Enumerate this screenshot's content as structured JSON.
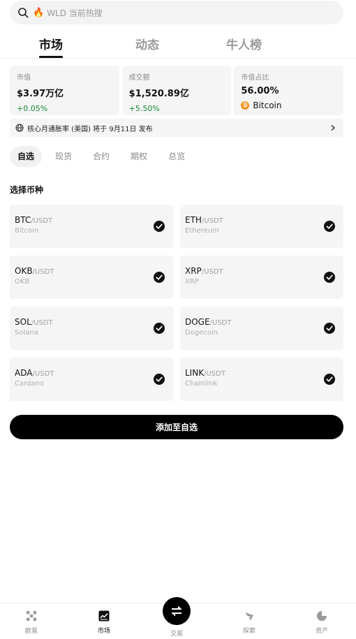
{
  "search": {
    "placeholder": "WLD 当前热搜"
  },
  "tabs": [
    "市场",
    "动态",
    "牛人榜"
  ],
  "stats": [
    {
      "label": "市值",
      "value": "$3.97万亿",
      "change": "+0.05%"
    },
    {
      "label": "成交额",
      "value": "$1,520.89亿",
      "change": "+5.50%"
    },
    {
      "label": "市值占比",
      "value": "56.00%",
      "coin": "Bitcoin"
    }
  ],
  "notice": {
    "text": "核心月通胀率 (美国) 将于 9月11日 发布"
  },
  "subtabs": [
    "自选",
    "现货",
    "合约",
    "期权",
    "总览"
  ],
  "section_title": "选择币种",
  "coins": [
    {
      "base": "BTC",
      "quote": "/USDT",
      "name": "Bitcoin",
      "checked": true
    },
    {
      "base": "ETH",
      "quote": "/USDT",
      "name": "Ethereum",
      "checked": true
    },
    {
      "base": "OKB",
      "quote": "/USDT",
      "name": "OKB",
      "checked": true
    },
    {
      "base": "XRP",
      "quote": "/USDT",
      "name": "XRP",
      "checked": true
    },
    {
      "base": "SOL",
      "quote": "/USDT",
      "name": "Solana",
      "checked": true
    },
    {
      "base": "DOGE",
      "quote": "/USDT",
      "name": "Dogecoin",
      "checked": true
    },
    {
      "base": "ADA",
      "quote": "/USDT",
      "name": "Cardano",
      "checked": true
    },
    {
      "base": "LINK",
      "quote": "/USDT",
      "name": "Chainlink",
      "checked": true
    }
  ],
  "add_button": "添加至自选",
  "nav": [
    {
      "label": "欧易",
      "icon": "okx-logo-icon"
    },
    {
      "label": "市场",
      "icon": "market-chart-icon"
    },
    {
      "label": "交易",
      "icon": "trade-swap-icon"
    },
    {
      "label": "探索",
      "icon": "explore-compass-icon"
    },
    {
      "label": "资产",
      "icon": "assets-pie-icon"
    }
  ],
  "colors": {
    "positive": "#1a8a3a",
    "bitcoin": "#f7931a",
    "primary": "#000000"
  }
}
